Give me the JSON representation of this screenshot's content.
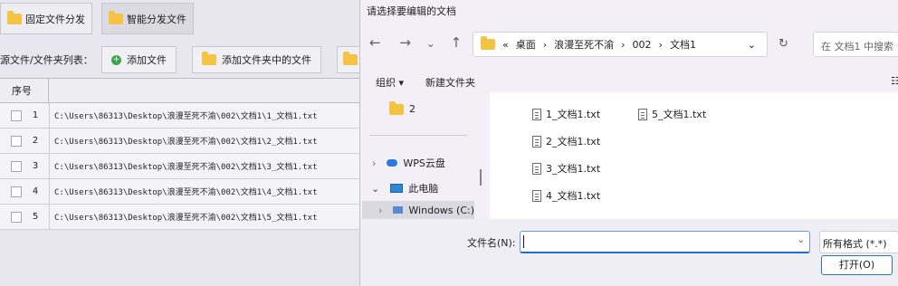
{
  "app": {
    "tabs": [
      {
        "label": "固定文件分发"
      },
      {
        "label": "智能分发文件"
      }
    ],
    "list_label": "源文件/文件夹列表：",
    "add_file_label": "添加文件",
    "add_folder_label": "添加文件夹中的文件",
    "table": {
      "header_no": "序号",
      "rows": [
        {
          "no": "1",
          "path": "C:\\Users\\86313\\Desktop\\浪漫至死不渝\\002\\文档1\\1_文档1.txt"
        },
        {
          "no": "2",
          "path": "C:\\Users\\86313\\Desktop\\浪漫至死不渝\\002\\文档1\\2_文档1.txt"
        },
        {
          "no": "3",
          "path": "C:\\Users\\86313\\Desktop\\浪漫至死不渝\\002\\文档1\\3_文档1.txt"
        },
        {
          "no": "4",
          "path": "C:\\Users\\86313\\Desktop\\浪漫至死不渝\\002\\文档1\\4_文档1.txt"
        },
        {
          "no": "5",
          "path": "C:\\Users\\86313\\Desktop\\浪漫至死不渝\\002\\文档1\\5_文档1.txt"
        }
      ]
    }
  },
  "dialog": {
    "title": "请选择要编辑的文档",
    "nav": {
      "back": "←",
      "forward": "→",
      "recent": "⌄",
      "up": "↑"
    },
    "breadcrumb": [
      "«",
      "桌面",
      "›",
      "浪漫至死不渝",
      "›",
      "002",
      "›",
      "文档1"
    ],
    "address_dropdown": "⌄",
    "refresh": "↻",
    "search_placeholder": "在 文档1 中搜索",
    "toolbar": {
      "organize": "组织 ▾",
      "new_folder": "新建文件夹",
      "view": "☷"
    },
    "nav_pane": {
      "folder_2": "2",
      "wps": "WPS云盘",
      "this_pc": "此电脑",
      "windows_drive": "Windows (C:)",
      "chev_collapsed": "›",
      "chev_expanded": "⌄"
    },
    "files": [
      "1_文档1.txt",
      "5_文档1.txt",
      "2_文档1.txt",
      "3_文档1.txt",
      "4_文档1.txt"
    ],
    "filename_label": "文件名(N):",
    "filename_value": "",
    "filename_dropdown": "⌄",
    "filetype": "所有格式 (*.*)",
    "open_button": "打开(O)"
  }
}
